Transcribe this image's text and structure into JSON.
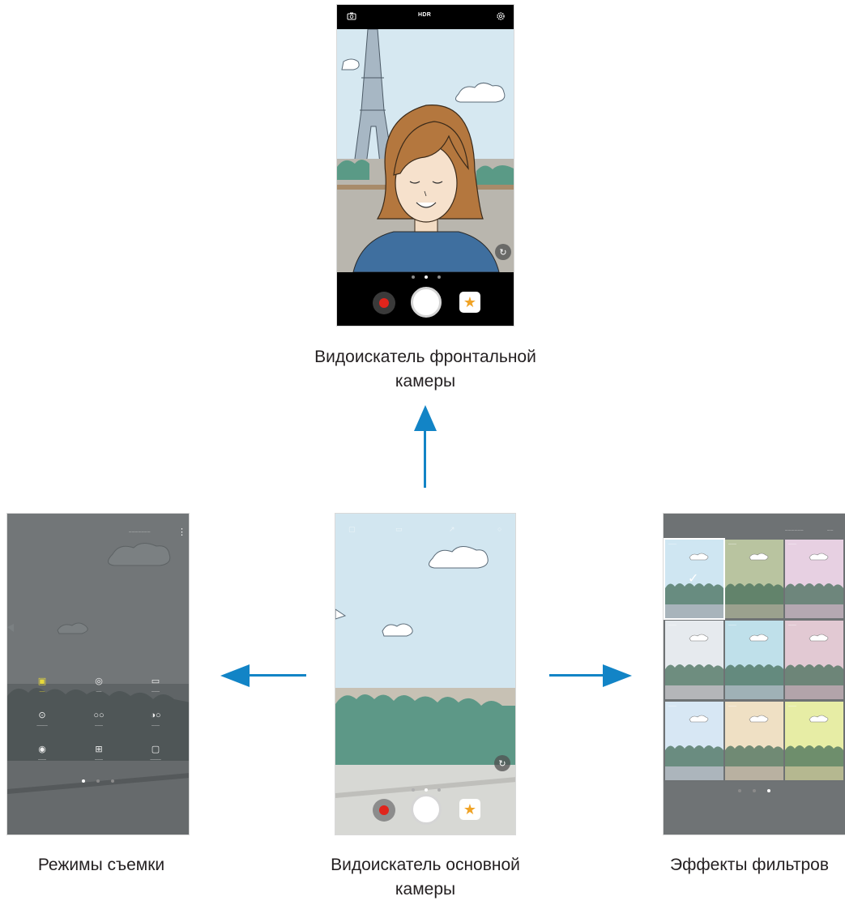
{
  "captions": {
    "front_line1": "Видоискатель фронтальной",
    "front_line2": "камеры",
    "main_line1": "Видоискатель основной",
    "main_line2": "камеры",
    "modes": "Режимы съемки",
    "filters": "Эффекты фильтров"
  },
  "front_camera": {
    "hdr_label": "HDR",
    "icons": [
      "switch-camera-icon",
      "hdr-icon",
      "settings-icon"
    ],
    "page_dots": 3,
    "active_dot": 2
  },
  "main_camera": {
    "icons": [
      "flash-icon",
      "hdr-icon",
      "timer-icon",
      "settings-icon"
    ],
    "page_dots": 3,
    "active_dot": 2
  },
  "modes_screen": {
    "active_dot": 1,
    "page_dots": 3,
    "modes": [
      {
        "icon": "auto-icon",
        "active": true
      },
      {
        "icon": "pro-icon",
        "active": false
      },
      {
        "icon": "panorama-icon",
        "active": false
      },
      {
        "icon": "selective-focus-icon",
        "active": false
      },
      {
        "icon": "slow-motion-icon",
        "active": false
      },
      {
        "icon": "hyperlapse-icon",
        "active": false
      },
      {
        "icon": "food-icon",
        "active": false
      },
      {
        "icon": "download-icon",
        "active": false
      },
      {
        "icon": "video-icon",
        "active": false
      }
    ]
  },
  "filters_screen": {
    "active_dot": 3,
    "page_dots": 3,
    "tint_colors": [
      "#cfe6f2",
      "#b9c4a0",
      "#e7d0e2",
      "#e6eaee",
      "#bfe0ea",
      "#e2c9d3",
      "#d7e7f4",
      "#efe0c4",
      "#e7eda5"
    ]
  },
  "colors": {
    "arrow": "#1284c6",
    "record": "#e0241c",
    "gallery_star": "#f0a326",
    "active_mode": "#e7d93a"
  }
}
